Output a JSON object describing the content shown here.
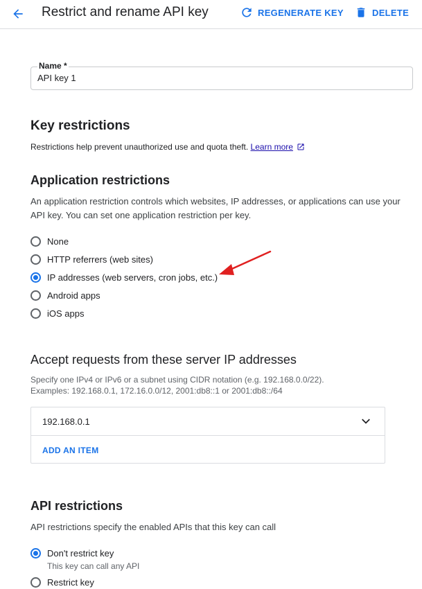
{
  "header": {
    "title": "Restrict and rename API key",
    "regenerate_label": "REGENERATE KEY",
    "delete_label": "DELETE"
  },
  "name_field": {
    "label": "Name *",
    "value": "API key 1"
  },
  "key_restrictions": {
    "title": "Key restrictions",
    "description": "Restrictions help prevent unauthorized use and quota theft.",
    "learn_more": "Learn more"
  },
  "application_restrictions": {
    "title": "Application restrictions",
    "description": "An application restriction controls which websites, IP addresses, or applications can use your API key. You can set one application restriction per key.",
    "options": [
      {
        "label": "None",
        "selected": false
      },
      {
        "label": "HTTP referrers (web sites)",
        "selected": false
      },
      {
        "label": "IP addresses (web servers, cron jobs, etc.)",
        "selected": true
      },
      {
        "label": "Android apps",
        "selected": false
      },
      {
        "label": "iOS apps",
        "selected": false
      }
    ]
  },
  "ip_section": {
    "title": "Accept requests from these server IP addresses",
    "description_line1": "Specify one IPv4 or IPv6 or a subnet using CIDR notation (e.g. 192.168.0.0/22).",
    "description_line2": "Examples: 192.168.0.1, 172.16.0.0/12, 2001:db8::1 or 2001:db8::/64",
    "items": [
      "192.168.0.1"
    ],
    "add_item_label": "ADD AN ITEM"
  },
  "api_restrictions": {
    "title": "API restrictions",
    "description": "API restrictions specify the enabled APIs that this key can call",
    "options": [
      {
        "label": "Don't restrict key",
        "sub": "This key can call any API",
        "selected": true
      },
      {
        "label": "Restrict key",
        "selected": false
      }
    ]
  },
  "colors": {
    "accent": "#1a73e8",
    "annotation_arrow": "#e02020"
  },
  "icons": {
    "back": "arrow-back-icon",
    "regenerate": "refresh-icon",
    "delete": "trash-icon",
    "external": "external-link-icon",
    "expand": "chevron-down-icon"
  }
}
